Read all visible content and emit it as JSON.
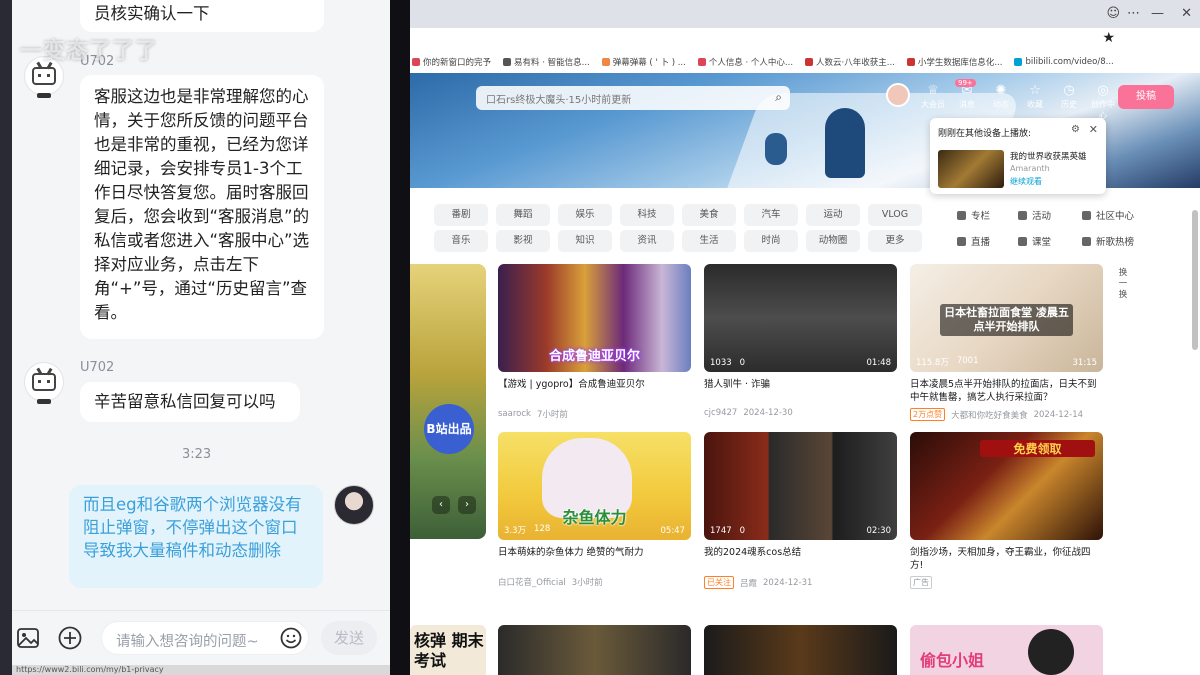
{
  "overlay_text": "一变态了了了",
  "chat": {
    "messages": [
      {
        "kind": "agent",
        "text": "员核实确认一下"
      },
      {
        "kind": "agent",
        "sender": "U702",
        "text": "客服这边也是非常理解您的心情，关于您所反馈的问题平台也是非常的重视，已经为您详细记录，会安排专员1-3个工作日尽快答复您。届时客服回复后，您会收到“客服消息”的私信或者您进入“客服中心”选择对应业务，点击左下角“+”号，通过“历史留言”查看。"
      },
      {
        "kind": "agent",
        "sender": "U702",
        "text": "辛苦留意私信回复可以吗"
      },
      {
        "kind": "user",
        "text": "而且eg和谷歌两个浏览器没有阻止弹窗，不停弹出这个窗口导致我大量稿件和动态删除"
      }
    ],
    "timestamp": "3:23",
    "input_placeholder": "请输入想咨询的问题~",
    "send_label": "发送",
    "status_url": "https://www2.bili.com/my/b1-privacy"
  },
  "browser": {
    "bookmarks": [
      "你的新窗口的完予",
      "易有料 · 智能信息...",
      "弹幕弹幕 ( ' 卜 ) ...",
      "个人信息 · 个人中心...",
      "人数云·八年收获主...",
      "小学生数据库信息化...",
      "bilibili.com/video/8..."
    ],
    "search_placeholder": "口石rs终极大魔头·15小时前更新",
    "header_icons": [
      {
        "label": "大会员",
        "icon": "crown-icon",
        "glyph": "♕"
      },
      {
        "label": "消息",
        "icon": "message-icon",
        "glyph": "✉",
        "badge": "99+"
      },
      {
        "label": "动态",
        "icon": "dynamic-icon",
        "glyph": "✺"
      },
      {
        "label": "收藏",
        "icon": "star-icon",
        "glyph": "☆"
      },
      {
        "label": "历史",
        "icon": "clock-icon",
        "glyph": "◷"
      },
      {
        "label": "创作中心",
        "icon": "lightbulb-icon",
        "glyph": "◎"
      }
    ],
    "upload_label": "投稿",
    "popup": {
      "title": "刚刚在其他设备上播放:",
      "video_title": "我的世界收获黑英雄",
      "uploader": "Amaranth",
      "link": "继续观看"
    },
    "categories_row1": [
      "番剧",
      "舞蹈",
      "娱乐",
      "科技",
      "美食",
      "汽车",
      "运动",
      "VLOG"
    ],
    "categories_row2": [
      "音乐",
      "影视",
      "知识",
      "资讯",
      "生活",
      "时尚",
      "动物圈",
      "更多"
    ],
    "side_categories": [
      "专栏",
      "活动",
      "社区中心",
      "直播",
      "课堂",
      "新歌热榜"
    ],
    "carousel_badge": "B站出品",
    "refresh_label": "换一换",
    "videos": [
      {
        "caption": "合成鲁迪亚贝尔",
        "views": "",
        "danmaku": "",
        "duration": "",
        "title": "【游戏 | ygopro】合成鲁迪亚贝尔",
        "uploader": "saarock",
        "date": "7小时前",
        "tag": ""
      },
      {
        "caption": "",
        "views": "1033",
        "danmaku": "0",
        "duration": "01:48",
        "title": "猎人驯牛 · 诈骗",
        "uploader": "cjc9427",
        "date": "2024-12-30",
        "tag": ""
      },
      {
        "caption": "日本社畜拉面食堂 凌晨五点半开始排队",
        "views": "115.8万",
        "danmaku": "7001",
        "duration": "31:15",
        "title": "日本凌晨5点半开始排队的拉面店，日夫不到中午就售罄，搞艺人执行采拉面？",
        "uploader": "大都和你吃好食美食",
        "date": "2024-12-14",
        "tag": "2万点赞"
      },
      {
        "caption": "杂鱼体力",
        "views": "3.3万",
        "danmaku": "128",
        "duration": "05:47",
        "title": "日本萌妹的杂鱼体力 绝赞的气耐力",
        "uploader": "白口花音_Official",
        "date": "3小时前",
        "tag": ""
      },
      {
        "caption": "",
        "views": "1747",
        "danmaku": "0",
        "duration": "02:30",
        "title": "我的2024魂系cos总结",
        "uploader": "吕霞",
        "date": "2024-12-31",
        "tag": "已关注"
      },
      {
        "caption": "免费领取",
        "views": "",
        "danmaku": "",
        "duration": "",
        "title": "剑指沙场，天相加身，夺王霸业，你征战四方!",
        "uploader": "",
        "date": "",
        "tag": "广告"
      }
    ],
    "bottom_captions": [
      "核弹 期末考试",
      "",
      "",
      "偷包小姐"
    ]
  }
}
